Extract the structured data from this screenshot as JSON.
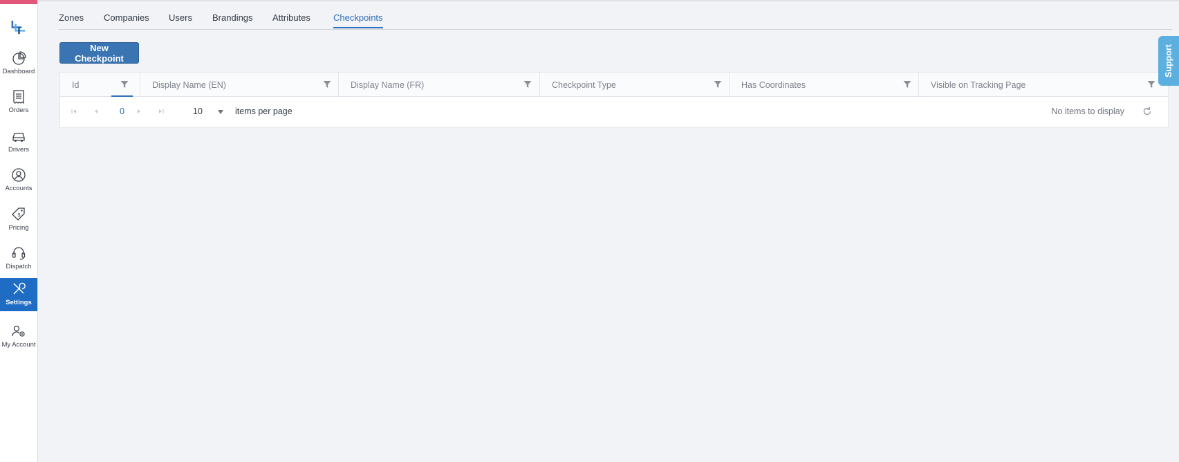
{
  "sidebar": {
    "items": [
      {
        "label": "Dashboard",
        "icon": "pie-chart-icon"
      },
      {
        "label": "Orders",
        "icon": "receipt-icon"
      },
      {
        "label": "Drivers",
        "icon": "car-icon"
      },
      {
        "label": "Accounts",
        "icon": "user-circle-icon"
      },
      {
        "label": "Pricing",
        "icon": "price-tag-icon"
      },
      {
        "label": "Dispatch",
        "icon": "headset-icon"
      },
      {
        "label": "Settings",
        "icon": "tools-icon",
        "active": true
      },
      {
        "label": "My Account",
        "icon": "user-gear-icon"
      }
    ]
  },
  "tabs": [
    {
      "label": "Zones"
    },
    {
      "label": "Companies"
    },
    {
      "label": "Users"
    },
    {
      "label": "Brandings"
    },
    {
      "label": "Attributes"
    },
    {
      "label": "Checkpoints",
      "active": true
    }
  ],
  "toolbar": {
    "new_label": "New Checkpoint"
  },
  "grid": {
    "columns": [
      {
        "title": "Id"
      },
      {
        "title": "Display Name (EN)"
      },
      {
        "title": "Display Name (FR)"
      },
      {
        "title": "Checkpoint Type"
      },
      {
        "title": "Has Coordinates"
      },
      {
        "title": "Visible on Tracking Page"
      }
    ],
    "pager": {
      "current_page": "0",
      "page_size": "10",
      "items_per_page_label": "items per page",
      "info": "No items to display"
    }
  },
  "support": {
    "label": "Support"
  },
  "colors": {
    "accent": "#1f6cc4",
    "button": "#3a74b2",
    "active_tab": "#2f6fb8",
    "sidebar_top_bar": "#e2587b",
    "support_tab": "#5bb0e0"
  }
}
